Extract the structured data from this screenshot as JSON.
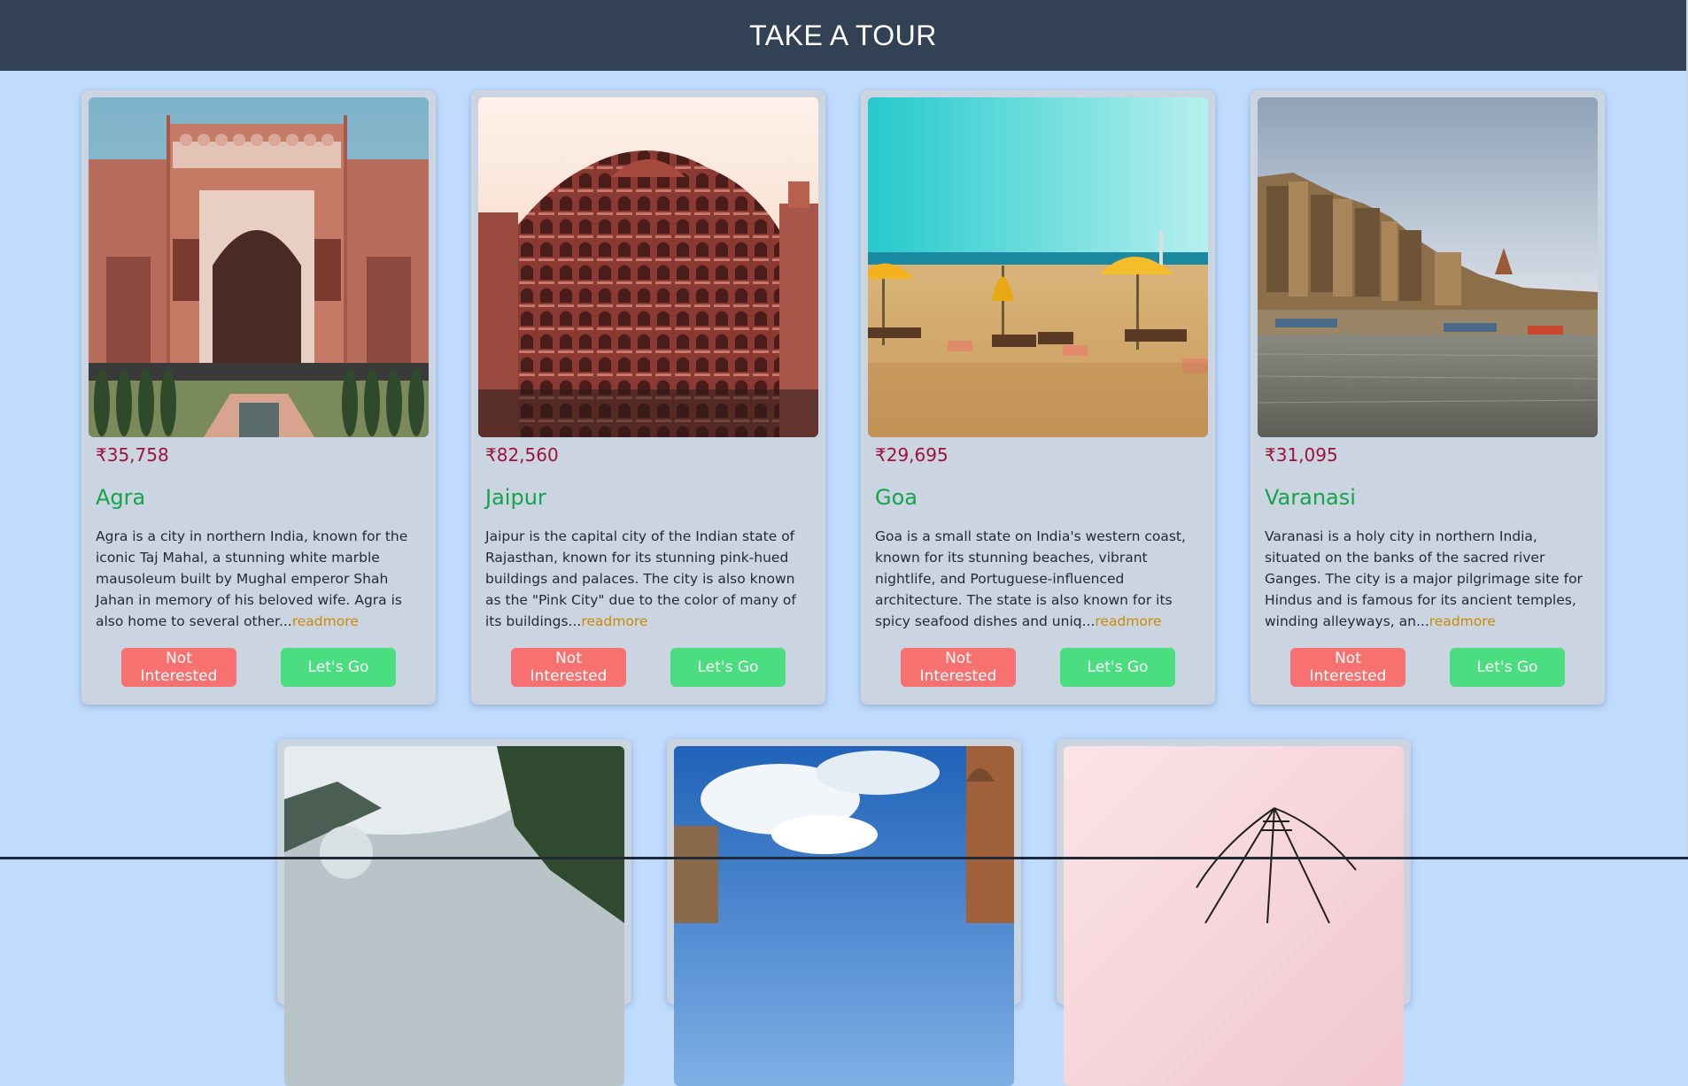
{
  "header": {
    "title": "TAKE A TOUR"
  },
  "tours": [
    {
      "price": "₹35,758",
      "name": "Agra",
      "description": "Agra is a city in northern India, known for the iconic Taj Mahal, a stunning white marble mausoleum built by Mughal emperor Shah Jahan in memory of his beloved wife. Agra is also home to several other...",
      "readmore": "readmore",
      "not_interested": "Not Interested",
      "lets_go": "Let's Go"
    },
    {
      "price": "₹82,560",
      "name": "Jaipur",
      "description": "Jaipur is the capital city of the Indian state of Rajasthan, known for its stunning pink-hued buildings and palaces. The city is also known as the \"Pink City\" due to the color of many of its buildings...",
      "readmore": "readmore",
      "not_interested": "Not Interested",
      "lets_go": "Let's Go"
    },
    {
      "price": "₹29,695",
      "name": "Goa",
      "description": "Goa is a small state on India's western coast, known for its stunning beaches, vibrant nightlife, and Portuguese-influenced architecture. The state is also known for its spicy seafood dishes and uniq...",
      "readmore": "readmore",
      "not_interested": "Not Interested",
      "lets_go": "Let's Go"
    },
    {
      "price": "₹31,095",
      "name": "Varanasi",
      "description": "Varanasi is a holy city in northern India, situated on the banks of the sacred river Ganges. The city is a major pilgrimage site for Hindus and is famous for its ancient temples, winding alleyways, an...",
      "readmore": "readmore",
      "not_interested": "Not Interested",
      "lets_go": "Let's Go"
    }
  ],
  "colors": {
    "page_background": "#bfdbfe",
    "header_background": "#334155",
    "card_background": "#cbd5e1",
    "price": "#9f1239",
    "title": "#16a34a",
    "readmore": "#ca8a04",
    "not_interested_button": "#f87171",
    "lets_go_button": "#4ade80"
  }
}
